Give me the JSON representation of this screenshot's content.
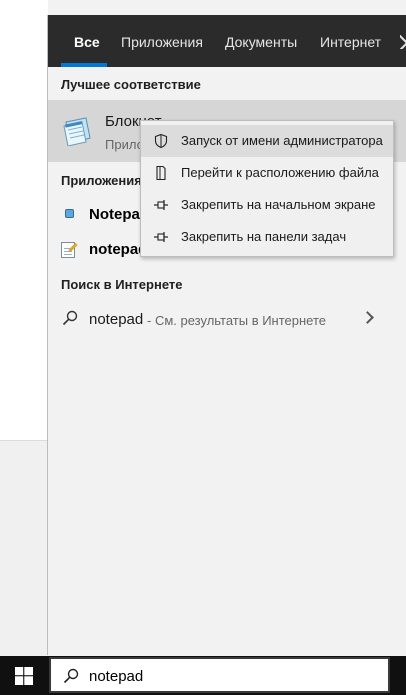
{
  "tabs": [
    {
      "label": "Все",
      "active": true
    },
    {
      "label": "Приложения"
    },
    {
      "label": "Документы"
    },
    {
      "label": "Интернет"
    }
  ],
  "sections": {
    "best_match": "Лучшее соответствие",
    "apps": "Приложения",
    "web": "Поиск в Интернете"
  },
  "best_match": {
    "name": "Блокнот",
    "type": "Прило",
    "icon": "notepad-app-icon"
  },
  "apps": [
    {
      "label": "Notepad",
      "icon": "notepad-small-icon"
    },
    {
      "label": "notepad",
      "icon": "notepad-doc-icon"
    }
  ],
  "web": {
    "query": "notepad",
    "hint": "- См. результаты в Интернете",
    "icon": "search-icon"
  },
  "context_menu": [
    {
      "label": "Запуск от имени администратора",
      "icon": "shield-icon",
      "highlighted": true
    },
    {
      "label": "Перейти к расположению файла",
      "icon": "file-location-icon"
    },
    {
      "label": "Закрепить на начальном экране",
      "icon": "pin-icon"
    },
    {
      "label": "Закрепить на панели задач",
      "icon": "pin-taskbar-icon"
    }
  ],
  "taskbar": {
    "search_value": "notepad",
    "start_icon": "windows-logo-icon"
  },
  "colors": {
    "accent": "#0078d7",
    "tabbar": "#2b2b2b",
    "panel": "#f2f2f2",
    "highlight": "#d6d6d6",
    "taskbar": "#101010"
  }
}
